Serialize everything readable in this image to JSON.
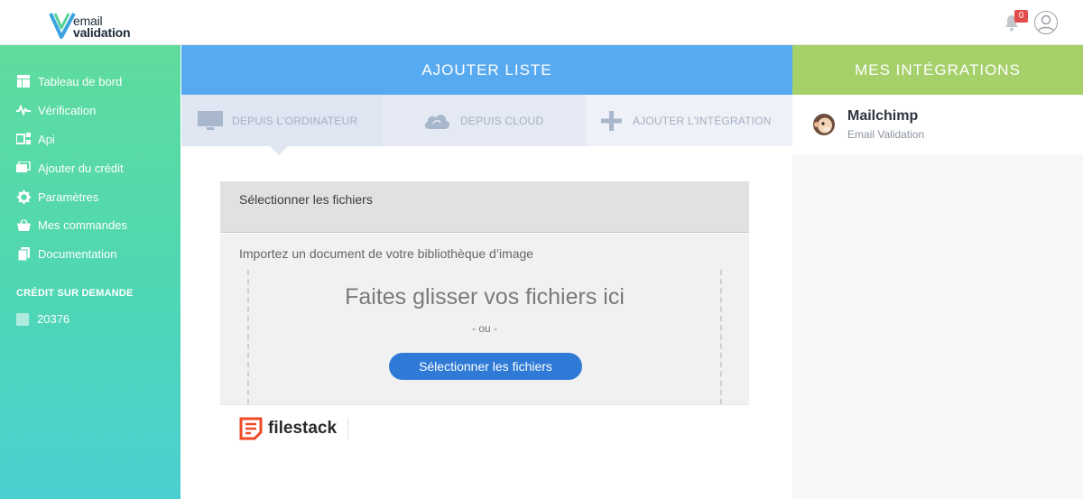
{
  "brand": {
    "line1": "email",
    "line2": "validation"
  },
  "header": {
    "notification_count": "0"
  },
  "sidebar": {
    "items": [
      {
        "label": "Tableau de bord",
        "icon": "dashboard-icon"
      },
      {
        "label": "Vérification",
        "icon": "activity-icon"
      },
      {
        "label": "Api",
        "icon": "api-icon"
      },
      {
        "label": "Ajouter du crédit",
        "icon": "credit-card-icon"
      },
      {
        "label": "Paramètres",
        "icon": "gear-icon"
      },
      {
        "label": "Mes commandes",
        "icon": "basket-icon"
      },
      {
        "label": "Documentation",
        "icon": "document-icon"
      }
    ],
    "credit_section_label": "CRÉDIT SUR DEMANDE",
    "credit_value": "20376"
  },
  "main": {
    "title": "AJOUTER LISTE",
    "tabs": [
      {
        "label": "DEPUIS L'ORDINATEUR",
        "icon": "monitor-icon"
      },
      {
        "label": "DEPUIS CLOUD",
        "icon": "cloud-icon"
      },
      {
        "label": "AJOUTER L'INTÉGRATION",
        "icon": "plus-icon"
      }
    ]
  },
  "integrations": {
    "title": "MES INTÉGRATIONS",
    "items": [
      {
        "name": "Mailchimp",
        "subtitle": "Email Validation",
        "icon": "mailchimp-icon"
      }
    ]
  },
  "picker": {
    "header": "Sélectionner les fichiers",
    "hint": "Importez un document de votre bibliothèque d’image",
    "drop_title": "Faites glisser vos fichiers ici",
    "or_text": "- ou -",
    "button_label": "Sélectionner les fichiers",
    "brand": "filestack"
  },
  "colors": {
    "sidebar_gradient_top": "#5fdc9d",
    "sidebar_gradient_bottom": "#4ccfd2",
    "primary_blue": "#58aaf0",
    "integration_green": "#a5d06a",
    "button_blue": "#2f7ad6",
    "badge_red": "#e34b4b"
  }
}
